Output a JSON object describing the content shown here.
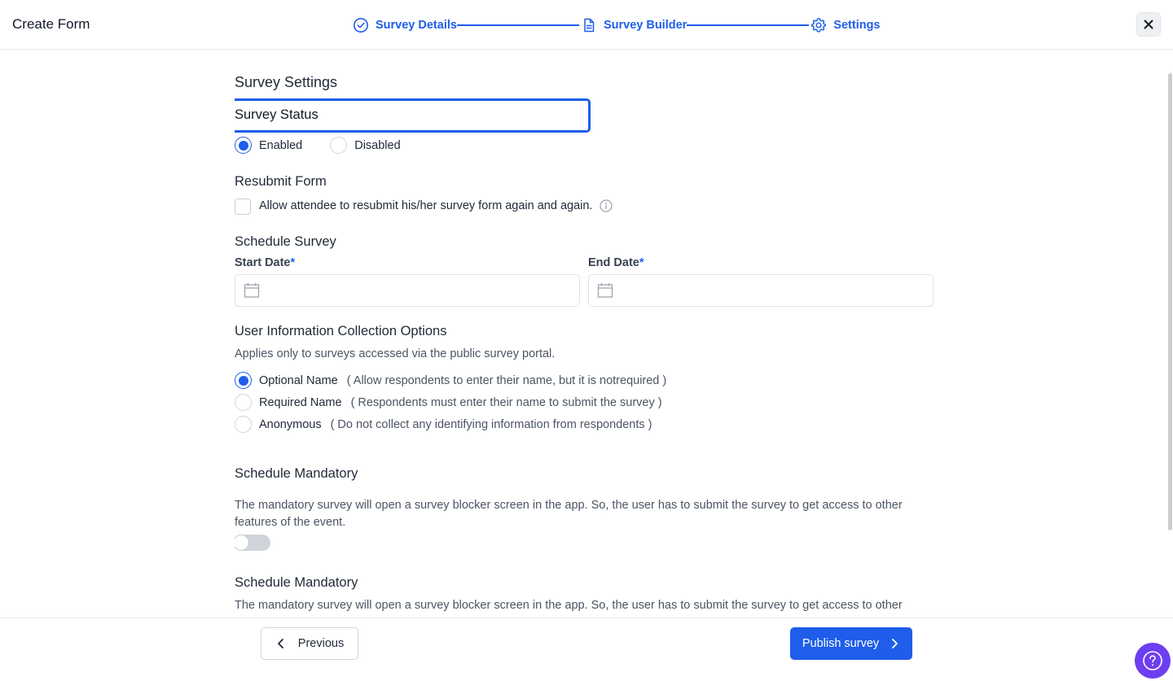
{
  "header": {
    "title": "Create Form",
    "steps": [
      {
        "label": "Survey Details",
        "icon": "check-circle-icon"
      },
      {
        "label": "Survey Builder",
        "icon": "document-icon"
      },
      {
        "label": "Settings",
        "icon": "gear-icon"
      }
    ]
  },
  "settings": {
    "title": "Survey Settings",
    "status": {
      "label": "Survey Status",
      "options": [
        {
          "label": "Enabled",
          "checked": true
        },
        {
          "label": "Disabled",
          "checked": false
        }
      ]
    },
    "resubmit": {
      "title": "Resubmit Form",
      "checkbox_label": "Allow attendee to resubmit his/her survey form again and again.",
      "checked": false
    },
    "schedule": {
      "title": "Schedule Survey",
      "start_label": "Start Date",
      "end_label": "End Date",
      "required_mark": "*"
    },
    "user_info": {
      "title": "User Information Collection Options",
      "subtitle": "Applies only to surveys accessed via the public survey portal.",
      "options": [
        {
          "label": "Optional Name",
          "desc": "( Allow respondents to enter their name, but it is notrequired )",
          "checked": true
        },
        {
          "label": "Required Name",
          "desc": "( Respondents must enter their name to submit the survey )",
          "checked": false
        },
        {
          "label": "Anonymous",
          "desc": "( Do not collect any identifying information from respondents )",
          "checked": false
        }
      ]
    },
    "mandatory": {
      "title": "Schedule Mandatory",
      "desc": "The mandatory survey will open a survey blocker screen in the app. So, the user has to submit the survey to get access to other features of the event.",
      "enabled": false
    },
    "mandatory2": {
      "title": "Schedule Mandatory",
      "desc": "The mandatory survey will open a survey blocker screen in the app. So, the user has to submit the survey to get access to other"
    }
  },
  "footer": {
    "previous_label": "Previous",
    "publish_label": "Publish survey"
  },
  "colors": {
    "accent": "#1e5eea",
    "help": "#6d3ff0"
  }
}
